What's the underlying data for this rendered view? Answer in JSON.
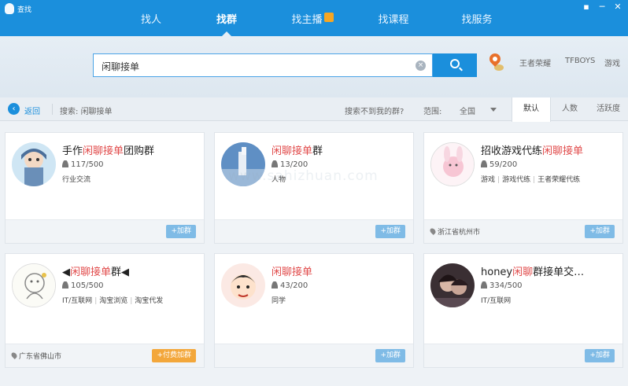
{
  "window": {
    "title": "查找",
    "controls": [
      "▪",
      "─",
      "✕"
    ]
  },
  "tabs": [
    {
      "label": "找人",
      "active": false
    },
    {
      "label": "找群",
      "active": true
    },
    {
      "label": "找主播",
      "active": false
    },
    {
      "label": "找课程",
      "active": false
    },
    {
      "label": "找服务",
      "active": false
    }
  ],
  "search": {
    "value": "闲聊接单",
    "clear": "×",
    "hot_words": [
      "王者荣耀",
      "TFBOYS",
      "游戏"
    ]
  },
  "filter": {
    "back": "返回",
    "query_prefix": "搜索: ",
    "query": "闲聊接单",
    "not_found": "搜索不到我的群?",
    "range_label": "范围:",
    "range_value": "全国",
    "sort": [
      "默认",
      "人数",
      "活跃度"
    ]
  },
  "cards": [
    {
      "pre": "手作",
      "kw": "闲聊接单",
      "post": "团购群",
      "members": "117/500",
      "tags": [
        "行业交流"
      ],
      "location": "",
      "join": "+加群"
    },
    {
      "pre": "",
      "kw": "闲聊接单",
      "post": "群",
      "members": "13/200",
      "tags": [
        "人物"
      ],
      "location": "",
      "join": "+加群"
    },
    {
      "pre": "招收游戏代练",
      "kw": "闲聊接单",
      "post": "",
      "members": "59/200",
      "tags": [
        "游戏",
        "游戏代练",
        "王者荣耀代练"
      ],
      "location": "浙江省杭州市",
      "join": "+加群"
    },
    {
      "pre": "◀",
      "kw": "闲聊接单",
      "post": "群◀",
      "members": "105/500",
      "tags": [
        "IT/互联网",
        "淘宝浏览",
        "淘宝代发"
      ],
      "location": "广东省佛山市",
      "join": "+付费加群"
    },
    {
      "pre": "",
      "kw": "闲聊接单",
      "post": "",
      "members": "43/200",
      "tags": [
        "同学"
      ],
      "location": "",
      "join": "+加群"
    },
    {
      "pre": "honey",
      "kw": "闲聊",
      "post": "群接单交…",
      "members": "334/500",
      "tags": [
        "IT/互联网"
      ],
      "location": "",
      "join": "+加群"
    }
  ],
  "watermark": "www.sahizhuan.com"
}
